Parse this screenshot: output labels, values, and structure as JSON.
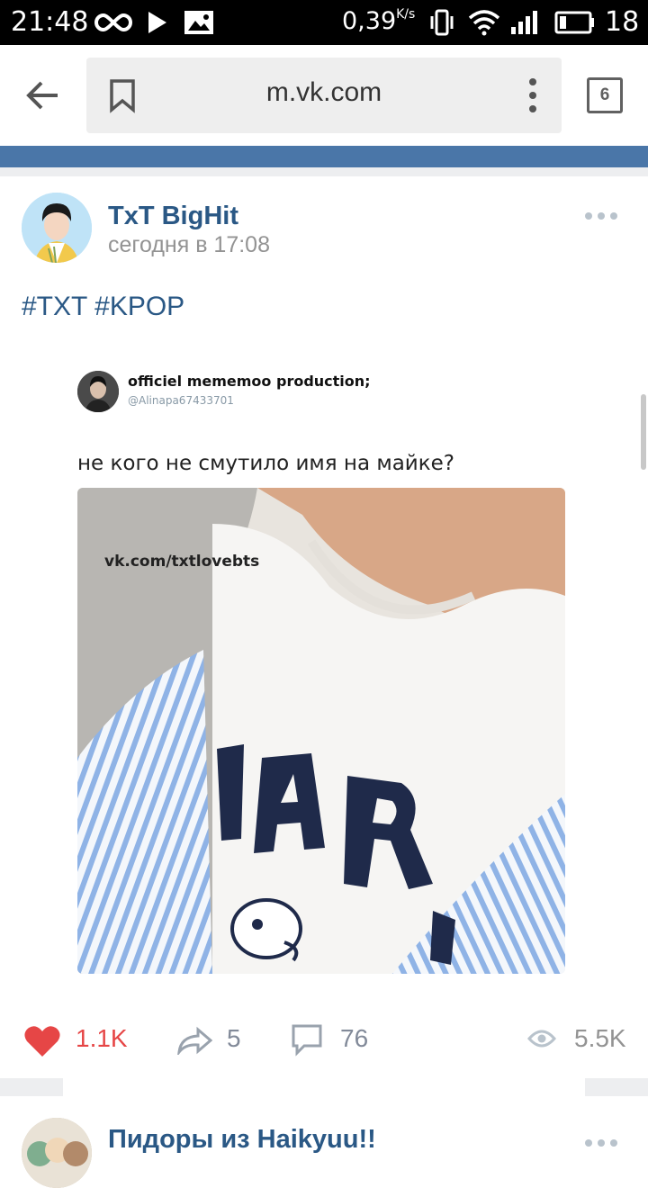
{
  "status_bar": {
    "time": "21:48",
    "speed": "0,39",
    "speed_unit": "K/s",
    "battery": "18",
    "icons": [
      "infinity-icon",
      "play-icon",
      "image-icon",
      "vibrate-icon",
      "wifi-icon",
      "signal-icon",
      "battery-icon"
    ]
  },
  "browser": {
    "url": "m.vk.com",
    "tab_count": "6"
  },
  "post": {
    "author": "TxT BigHit",
    "time": "сегодня в 17:08",
    "text": "#TXT #KPOP",
    "image": {
      "tweet_name": "officiel mememoo production;",
      "tweet_handle": "@Alinapa67433701",
      "tweet_text": "не кого не смутило имя на майке?",
      "watermark": "vk.com/txtlovebts"
    },
    "likes": "1.1K",
    "shares": "5",
    "comments": "76",
    "views": "5.5K"
  },
  "next_post": {
    "author": "Пидоры из Haikyuu!!"
  },
  "colors": {
    "vk_blue": "#4a76a8",
    "link": "#2a5885",
    "like_red": "#e64646",
    "muted": "#939393"
  }
}
